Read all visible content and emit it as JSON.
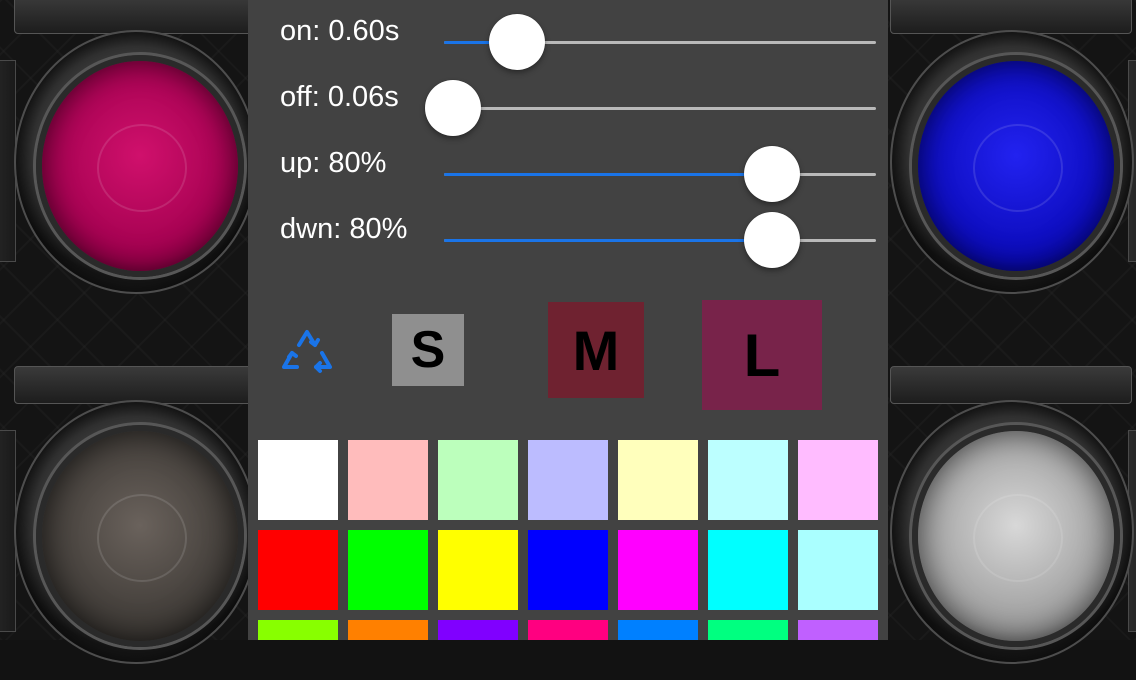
{
  "sliders": [
    {
      "id": "on",
      "label": "on: 0.60s",
      "value": 0.17
    },
    {
      "id": "off",
      "label": "off: 0.06s",
      "value": 0.02
    },
    {
      "id": "up",
      "label": "up: 80%",
      "value": 0.76
    },
    {
      "id": "dwn",
      "label": "dwn: 80%",
      "value": 0.76
    }
  ],
  "size_buttons": {
    "small": "S",
    "medium": "M",
    "large": "L"
  },
  "recycle_icon": "recycle-icon",
  "accent_color": "#1a74e8",
  "swatches": [
    [
      "#ffffff",
      "#ffbcbc",
      "#bcffbc",
      "#bcbcff",
      "#ffffbc",
      "#bcffff",
      "#ffbcff"
    ],
    [
      "#ff0000",
      "#00ff00",
      "#ffff00",
      "#0000ff",
      "#ff00ff",
      "#00ffff",
      "#aaffff"
    ],
    [
      "#88ff00",
      "#ff8000",
      "#8000ff",
      "#ff0080",
      "#0080ff",
      "#00ff80",
      "#c060ff"
    ]
  ],
  "background_lights": [
    "#c8006a",
    "#1414d8",
    "#4a4540",
    "#b8b8b8"
  ]
}
